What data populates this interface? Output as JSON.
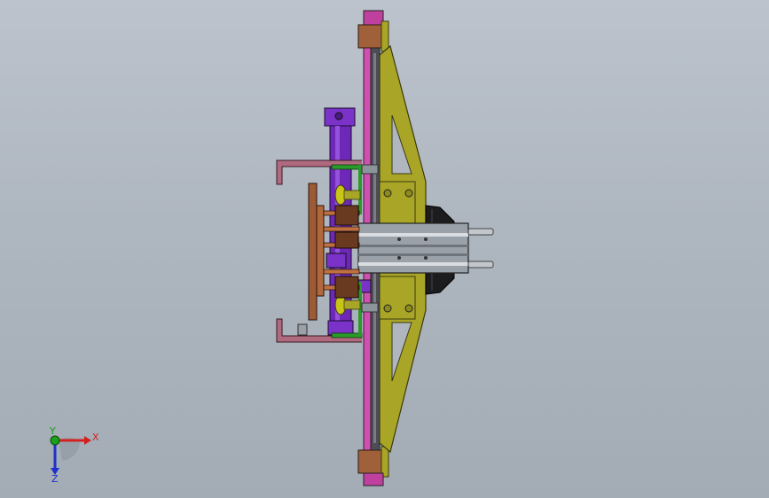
{
  "viewport": {
    "background_top": "#bcc3cc",
    "background_bottom": "#a3abb5"
  },
  "triad": {
    "x_label": "X",
    "y_label": "Y",
    "z_label": "Z",
    "x_color": "#d42020",
    "y_color": "#1aa01a",
    "z_color": "#2030c8"
  },
  "model": {
    "colors": {
      "frame_yellow": "#a9a526",
      "rail_pink": "#d050b0",
      "rail_dark": "#5a5a5a",
      "block_brown": "#9c5a36",
      "cylinder_purple": "#7a32c8",
      "bracket_pink": "#b06a80",
      "green": "#2a9a2a",
      "gray_block": "#8c949c",
      "black": "#1a1a1a",
      "rod_silver": "#b4b9be"
    }
  }
}
